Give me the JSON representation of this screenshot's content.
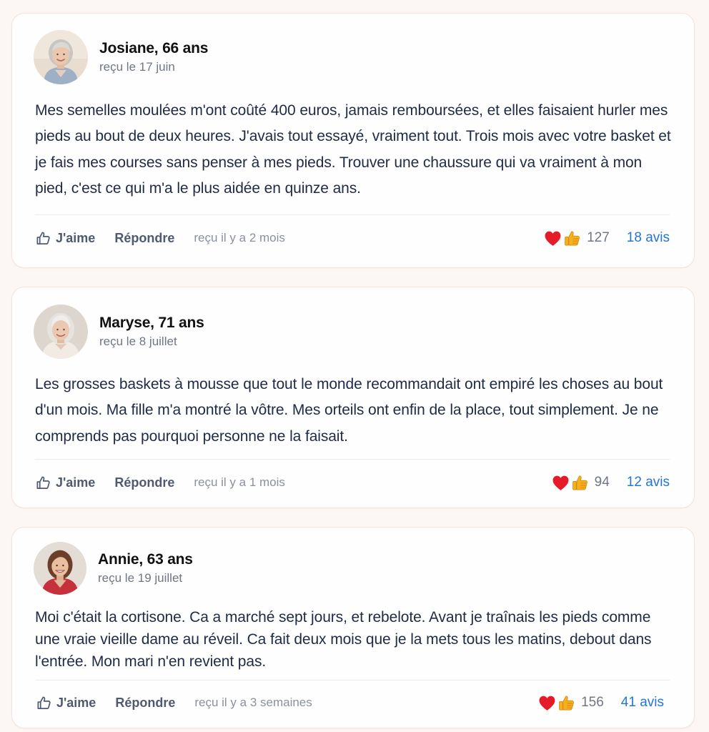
{
  "reviews": [
    {
      "name": "Josiane, 66 ans",
      "received": "reçu le 17 juin",
      "text": "Mes semelles moulées m'ont coûté 400 euros, jamais remboursées, et elles faisaient hurler mes pieds au bout de deux heures. J'avais tout essayé, vraiment tout. Trois mois avec votre basket et je fais mes courses sans penser à mes pieds. Trouver une chaussure qui va vraiment à mon pied, c'est ce qui m'a le plus aidée en quinze ans.",
      "like_label": "J'aime",
      "reply_label": "Répondre",
      "ago": "reçu il y a 2 mois",
      "reaction_icons": [
        "heart-icon",
        "thumbs-up-emoji-icon"
      ],
      "reaction_count": "127",
      "reviews_link": "18 avis"
    },
    {
      "name": "Maryse, 71 ans",
      "received": "reçu le 8 juillet",
      "text": "Les grosses baskets à mousse que tout le monde recommandait ont empiré les choses au bout d'un mois. Ma fille m'a montré la vôtre. Mes orteils ont enfin de la place, tout simplement. Je ne comprends pas pourquoi personne ne la faisait.",
      "like_label": "J'aime",
      "reply_label": "Répondre",
      "ago": "reçu il y a 1 mois",
      "reaction_icons": [
        "heart-icon",
        "thumbs-up-emoji-icon"
      ],
      "reaction_count": "94",
      "reviews_link": "12 avis"
    },
    {
      "name": "Annie, 63 ans",
      "received": "reçu le 19 juillet",
      "text": "Moi c'était la cortisone. Ca a marché sept jours, et rebelote. Avant je traînais les pieds comme une vraie vieille dame au réveil. Ca fait deux mois que je la mets tous les matins, debout dans l'entrée. Mon mari n'en revient pas.",
      "like_label": "J'aime",
      "reply_label": "Répondre",
      "ago": "reçu il y a 3 semaines",
      "reaction_icons": [
        "heart-icon",
        "thumbs-up-emoji-icon"
      ],
      "reaction_count": "156",
      "reviews_link": "41 avis"
    }
  ],
  "colors": {
    "page_background": "#fcf7f4",
    "card_background": "#fefefe",
    "name_text": "#111111",
    "body_text": "#1f2a44",
    "muted_text": "#6f7684",
    "action_text": "#4f5a70",
    "link": "#2575d6",
    "heart": "#e51b2a",
    "thumb": "#f6b01e"
  }
}
